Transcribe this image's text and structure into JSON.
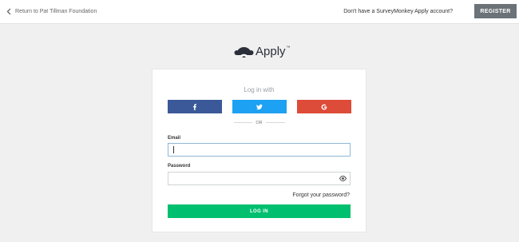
{
  "topbar": {
    "back_label": "Return to Pat Tillman Foundation",
    "no_account_text": "Don't have a SurveyMonkey Apply account?",
    "register_label": "REGISTER"
  },
  "brand": {
    "name": "Apply",
    "trademark": "™"
  },
  "login": {
    "heading": "Log in with",
    "social": [
      {
        "name": "facebook",
        "icon": "facebook-icon",
        "color": "#3b5998"
      },
      {
        "name": "twitter",
        "icon": "twitter-icon",
        "color": "#1da1f2"
      },
      {
        "name": "google",
        "icon": "google-icon",
        "color": "#dd4b39"
      }
    ],
    "divider_text": "OR",
    "email_label": "Email",
    "email_value": "",
    "password_label": "Password",
    "password_value": "",
    "forgot_label": "Forgot your password?",
    "submit_label": "LOG IN"
  },
  "colors": {
    "accent": "#00bf6f",
    "register": "#6b7378"
  }
}
